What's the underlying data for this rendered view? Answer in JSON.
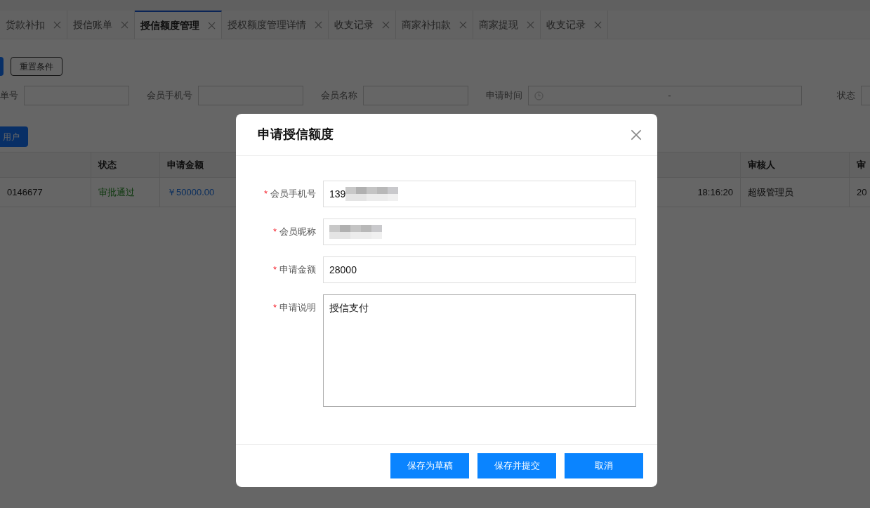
{
  "tabs": [
    {
      "label": "货款补扣",
      "selected": false
    },
    {
      "label": "授信账单",
      "selected": false
    },
    {
      "label": "授信额度管理",
      "selected": true
    },
    {
      "label": "授权额度管理详情",
      "selected": false
    },
    {
      "label": "收支记录",
      "selected": false
    },
    {
      "label": "商家补扣款",
      "selected": false
    },
    {
      "label": "商家提现",
      "selected": false
    },
    {
      "label": "收支记录",
      "selected": false
    }
  ],
  "toolbar": {
    "reset_button": "重置条件"
  },
  "filters": [
    {
      "kind": "text",
      "label": "单号"
    },
    {
      "kind": "text",
      "label": "会员手机号"
    },
    {
      "kind": "text",
      "label": "会员名称"
    },
    {
      "kind": "daterange",
      "label": "申请时间",
      "separator": "-"
    },
    {
      "kind": "select",
      "label": "状态"
    }
  ],
  "action_button": "用户",
  "table": {
    "columns": [
      "",
      "状态",
      "申请金额",
      "",
      "审核人",
      "审"
    ],
    "rows": [
      [
        "0146677",
        "审批通过",
        "￥50000.00",
        "18:16:20",
        "超级管理员",
        "20"
      ]
    ]
  },
  "dialog": {
    "title": "申请授信额度",
    "fields": [
      {
        "kind": "input",
        "label": "会员手机号",
        "required_mark": "*",
        "value": "139",
        "redacted": true
      },
      {
        "kind": "input",
        "label": "会员昵称",
        "required_mark": "*",
        "redacted": true
      },
      {
        "kind": "input",
        "label": "申请金额",
        "required_mark": "*",
        "value": "28000",
        "redacted": false
      },
      {
        "kind": "textarea",
        "label": "申请说明",
        "required_mark": "*",
        "value": "授信支付"
      }
    ],
    "buttons": [
      "保存为草稿",
      "保存并提交",
      "取消"
    ]
  }
}
